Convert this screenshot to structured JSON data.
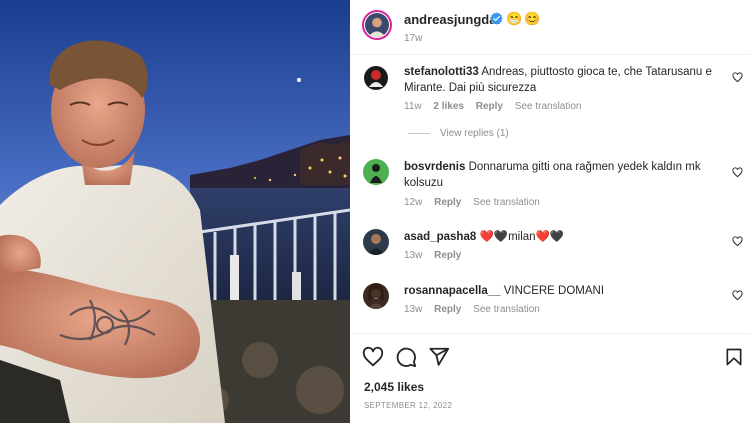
{
  "post": {
    "author": "andreasjungdal",
    "author_emoji": "😁😊",
    "time": "17w",
    "likes": "2,045 likes",
    "date": "SEPTEMBER 12, 2022"
  },
  "comments": [
    {
      "user": "stefanolotti33",
      "text": "Andreas, piuttosto gioca te, che Tatarusanu e Mirante. Dai più sicurezza",
      "time": "11w",
      "likes": "2 likes",
      "reply": "Reply",
      "translate": "See translation",
      "view_replies": "View replies (1)"
    },
    {
      "user": "bosvrdenis",
      "text": "Donnaruma gitti ona rağmen yedek kaldın mk kolsuzu",
      "time": "12w",
      "reply": "Reply",
      "translate": "See translation"
    },
    {
      "user": "asad_pasha8",
      "text": "❤️🖤milan❤️🖤",
      "time": "13w",
      "reply": "Reply"
    },
    {
      "user": "rosannapacella__",
      "text": "VINCERE DOMANI",
      "time": "13w",
      "reply": "Reply",
      "translate": "See translation"
    }
  ],
  "icons": [
    "heart-icon",
    "comment-icon",
    "share-icon",
    "bookmark-icon",
    "verified-badge-icon"
  ],
  "colors": {
    "verified": "#3897f0",
    "muted": "#8e8e8e",
    "text": "#262626",
    "story_ring": "#d6249f"
  }
}
